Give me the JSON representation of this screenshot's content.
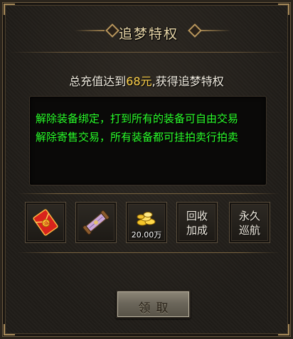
{
  "title": "追梦特权",
  "condition": {
    "prefix": "总充值达到",
    "amount": "68元",
    "suffix": ",获得追梦特权"
  },
  "description": {
    "lines": [
      "解除装备绑定，打到所有的装备可自由交易",
      "解除寄售交易，所有装备都可挂拍卖行拍卖"
    ]
  },
  "rewards": [
    {
      "icon": "red-envelope-icon",
      "label": "",
      "count": ""
    },
    {
      "icon": "scroll-icon",
      "label": "",
      "count": ""
    },
    {
      "icon": "gold-coins-icon",
      "label": "",
      "count": "20.00万"
    },
    {
      "icon": "",
      "label_line1": "回收",
      "label_line2": "加成",
      "count": ""
    },
    {
      "icon": "",
      "label_line1": "永久",
      "label_line2": "巡航",
      "count": ""
    }
  ],
  "claim_button": {
    "label": "领取"
  },
  "colors": {
    "title": "#e8d6a8",
    "amount_highlight": "#ffd24a",
    "description_text": "#2bff2b",
    "panel_border": "#6b5a3e"
  }
}
